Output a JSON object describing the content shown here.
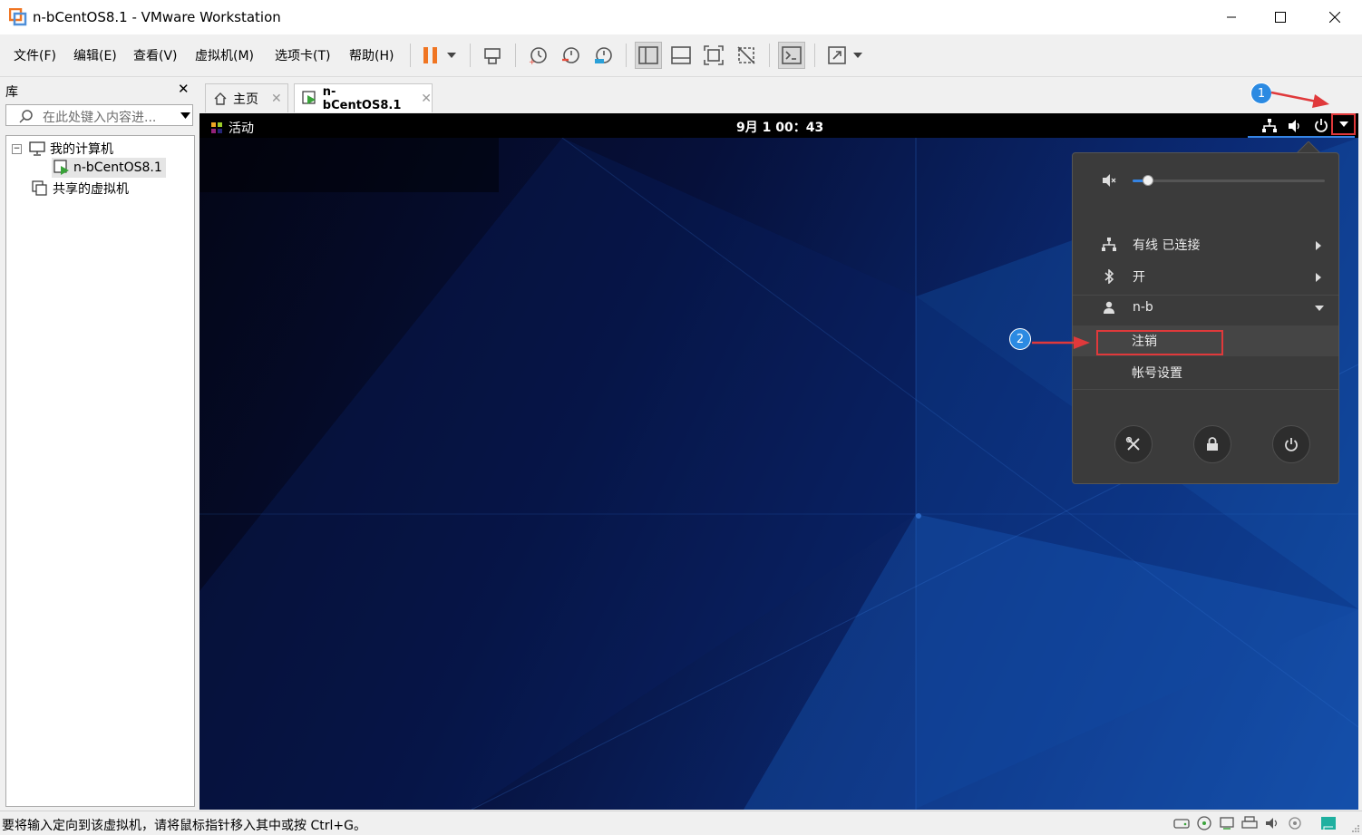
{
  "window": {
    "title": "n-bCentOS8.1 - VMware Workstation"
  },
  "menu": [
    "文件(F)",
    "编辑(E)",
    "查看(V)",
    "虚拟机(M)",
    "选项卡(T)",
    "帮助(H)"
  ],
  "library": {
    "title": "库",
    "search_placeholder": "在此处键入内容进...",
    "tree": {
      "my_computer": "我的计算机",
      "vm": "n-bCentOS8.1",
      "shared": "共享的虚拟机"
    }
  },
  "tabs": {
    "home": "主页",
    "vm": "n-bCentOS8.1"
  },
  "guest": {
    "activities": "活动",
    "clock": "9月 1 00：43",
    "volume_level": 0.08,
    "menu": {
      "wired": "有线 已连接",
      "bluetooth": "开",
      "user": "n-b",
      "logout": "注销",
      "account_settings": "帐号设置"
    }
  },
  "status": {
    "text": "要将输入定向到该虚拟机，请将鼠标指针移入其中或按 Ctrl+G。"
  },
  "annotations": {
    "badge1": "1",
    "badge2": "2"
  },
  "colors": {
    "highlight_red": "#e0393b",
    "badge_blue": "#2b8ae2",
    "pause_orange": "#f07522"
  }
}
